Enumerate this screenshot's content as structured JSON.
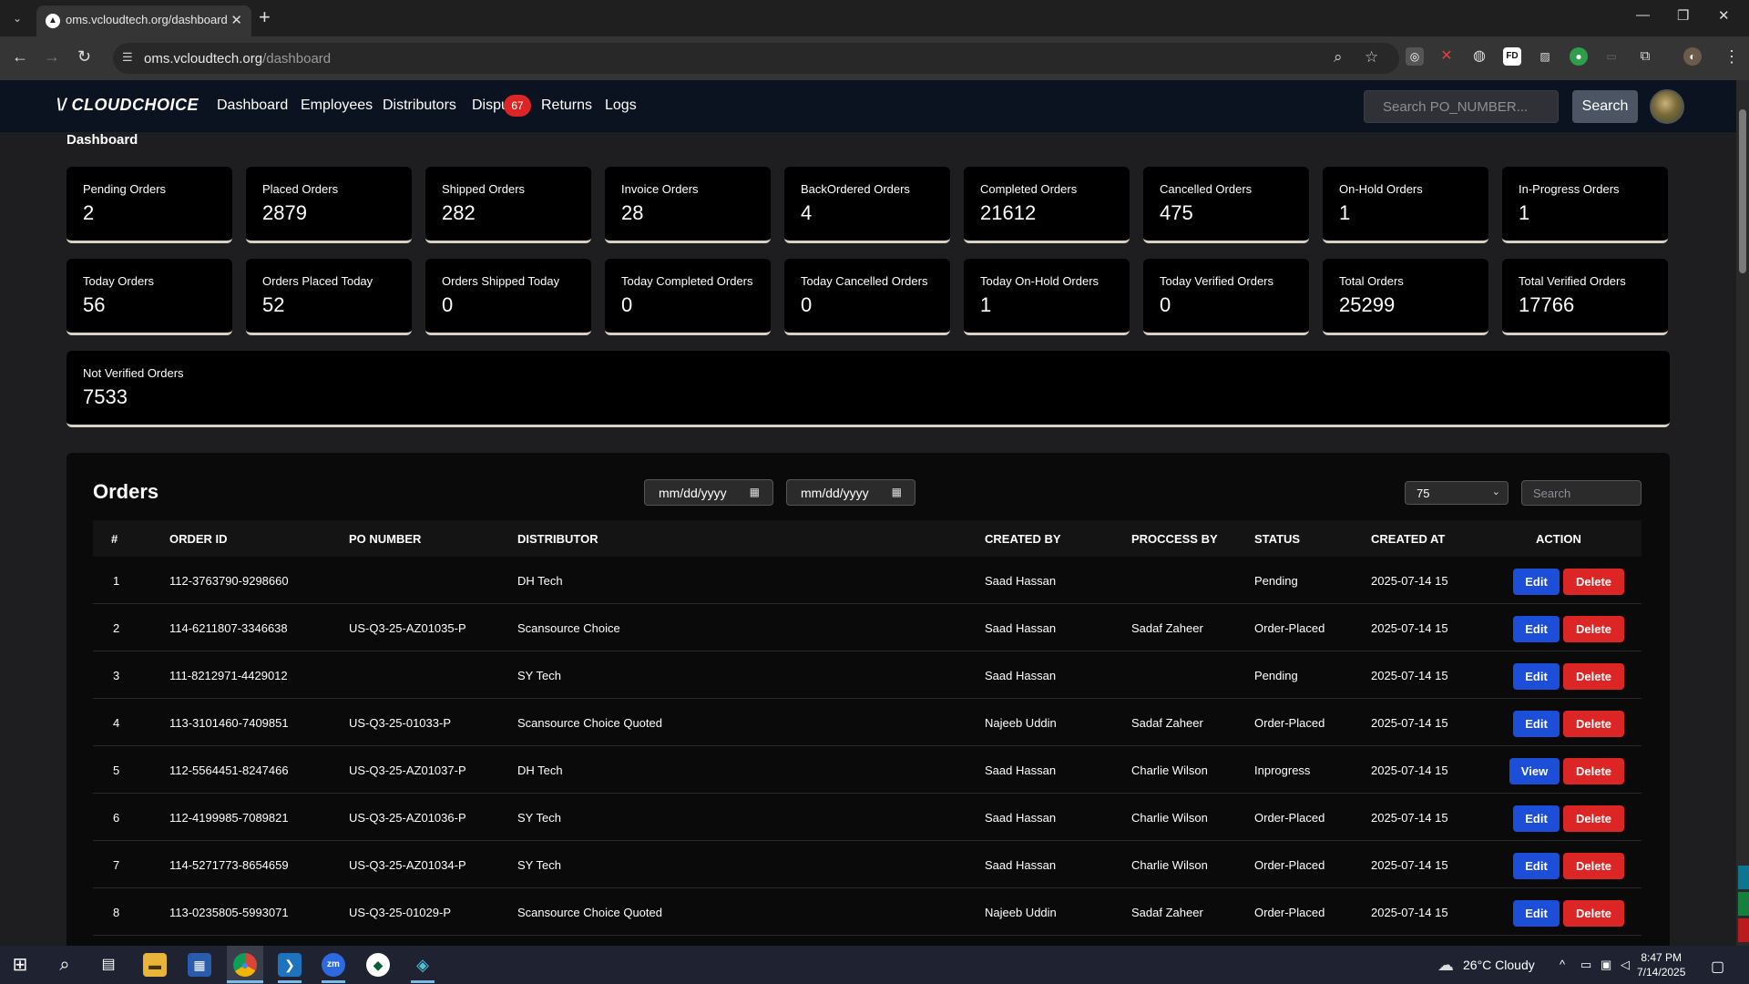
{
  "browser": {
    "tab_title": "oms.vcloudtech.org/dashboard",
    "url_host": "oms.vcloudtech.org",
    "url_path": "/dashboard"
  },
  "app": {
    "logo": "CLOUDCHOICE",
    "nav": [
      "Dashboard",
      "Employees",
      "Distributors",
      "Dispu",
      "Returns",
      "Logs"
    ],
    "disputes_badge": "67",
    "search_placeholder": "Search PO_NUMBER...",
    "search_button": "Search",
    "page_title": "Dashboard"
  },
  "stats": [
    {
      "label": "Pending Orders",
      "value": "2"
    },
    {
      "label": "Placed Orders",
      "value": "2879"
    },
    {
      "label": "Shipped Orders",
      "value": "282"
    },
    {
      "label": "Invoice Orders",
      "value": "28"
    },
    {
      "label": "BackOrdered Orders",
      "value": "4"
    },
    {
      "label": "Completed Orders",
      "value": "21612"
    },
    {
      "label": "Cancelled Orders",
      "value": "475"
    },
    {
      "label": "On-Hold Orders",
      "value": "1"
    },
    {
      "label": "In-Progress Orders",
      "value": "1"
    },
    {
      "label": "Today Orders",
      "value": "56"
    },
    {
      "label": "Orders Placed Today",
      "value": "52"
    },
    {
      "label": "Orders Shipped Today",
      "value": "0"
    },
    {
      "label": "Today Completed Orders",
      "value": "0"
    },
    {
      "label": "Today Cancelled Orders",
      "value": "0"
    },
    {
      "label": "Today On-Hold Orders",
      "value": "1"
    },
    {
      "label": "Today Verified Orders",
      "value": "0"
    },
    {
      "label": "Total Orders",
      "value": "25299"
    },
    {
      "label": "Total Verified Orders",
      "value": "17766"
    },
    {
      "label": "Not Verified Orders",
      "value": "7533"
    }
  ],
  "orders": {
    "title": "Orders",
    "date_from": "mm/dd/yyyy",
    "date_to": "mm/dd/yyyy",
    "page_size": "75",
    "search_placeholder": "Search",
    "columns": [
      "#",
      "ORDER ID",
      "PO NUMBER",
      "DISTRIBUTOR",
      "CREATED BY",
      "PROCCESS BY",
      "STATUS",
      "CREATED AT",
      "ACTION"
    ],
    "rows": [
      {
        "num": "1",
        "order_id": "112-3763790-9298660",
        "po": "",
        "distributor": "DH Tech",
        "created_by": "Saad Hassan",
        "process_by": "",
        "status": "Pending",
        "created_at": "2025-07-14 15",
        "action": "Edit",
        "delete": "Delete"
      },
      {
        "num": "2",
        "order_id": "114-6211807-3346638",
        "po": "US-Q3-25-AZ01035-P",
        "distributor": "Scansource Choice",
        "created_by": "Saad Hassan",
        "process_by": "Sadaf Zaheer",
        "status": "Order-Placed",
        "created_at": "2025-07-14 15",
        "action": "Edit",
        "delete": "Delete"
      },
      {
        "num": "3",
        "order_id": "111-8212971-4429012",
        "po": "",
        "distributor": "SY Tech",
        "created_by": "Saad Hassan",
        "process_by": "",
        "status": "Pending",
        "created_at": "2025-07-14 15",
        "action": "Edit",
        "delete": "Delete"
      },
      {
        "num": "4",
        "order_id": "113-3101460-7409851",
        "po": "US-Q3-25-01033-P",
        "distributor": "Scansource Choice Quoted",
        "created_by": "Najeeb Uddin",
        "process_by": "Sadaf Zaheer",
        "status": "Order-Placed",
        "created_at": "2025-07-14 15",
        "action": "Edit",
        "delete": "Delete"
      },
      {
        "num": "5",
        "order_id": "112-5564451-8247466",
        "po": "US-Q3-25-AZ01037-P",
        "distributor": "DH Tech",
        "created_by": "Saad Hassan",
        "process_by": "Charlie Wilson",
        "status": "Inprogress",
        "created_at": "2025-07-14 15",
        "action": "View",
        "delete": "Delete"
      },
      {
        "num": "6",
        "order_id": "112-4199985-7089821",
        "po": "US-Q3-25-AZ01036-P",
        "distributor": "SY Tech",
        "created_by": "Saad Hassan",
        "process_by": "Charlie Wilson",
        "status": "Order-Placed",
        "created_at": "2025-07-14 15",
        "action": "Edit",
        "delete": "Delete"
      },
      {
        "num": "7",
        "order_id": "114-5271773-8654659",
        "po": "US-Q3-25-AZ01034-P",
        "distributor": "SY Tech",
        "created_by": "Saad Hassan",
        "process_by": "Charlie Wilson",
        "status": "Order-Placed",
        "created_at": "2025-07-14 15",
        "action": "Edit",
        "delete": "Delete"
      },
      {
        "num": "8",
        "order_id": "113-0235805-5993071",
        "po": "US-Q3-25-01029-P",
        "distributor": "Scansource Choice Quoted",
        "created_by": "Najeeb Uddin",
        "process_by": "Sadaf Zaheer",
        "status": "Order-Placed",
        "created_at": "2025-07-14 15",
        "action": "Edit",
        "delete": "Delete"
      }
    ]
  },
  "taskbar": {
    "weather": "26°C  Cloudy",
    "time": "8:47 PM",
    "date": "7/14/2025"
  },
  "colors": {
    "nav_bg": "#0b1220",
    "edit_blue": "#1d4ed8",
    "delete_red": "#dc2626",
    "card_bg": "#000000"
  }
}
